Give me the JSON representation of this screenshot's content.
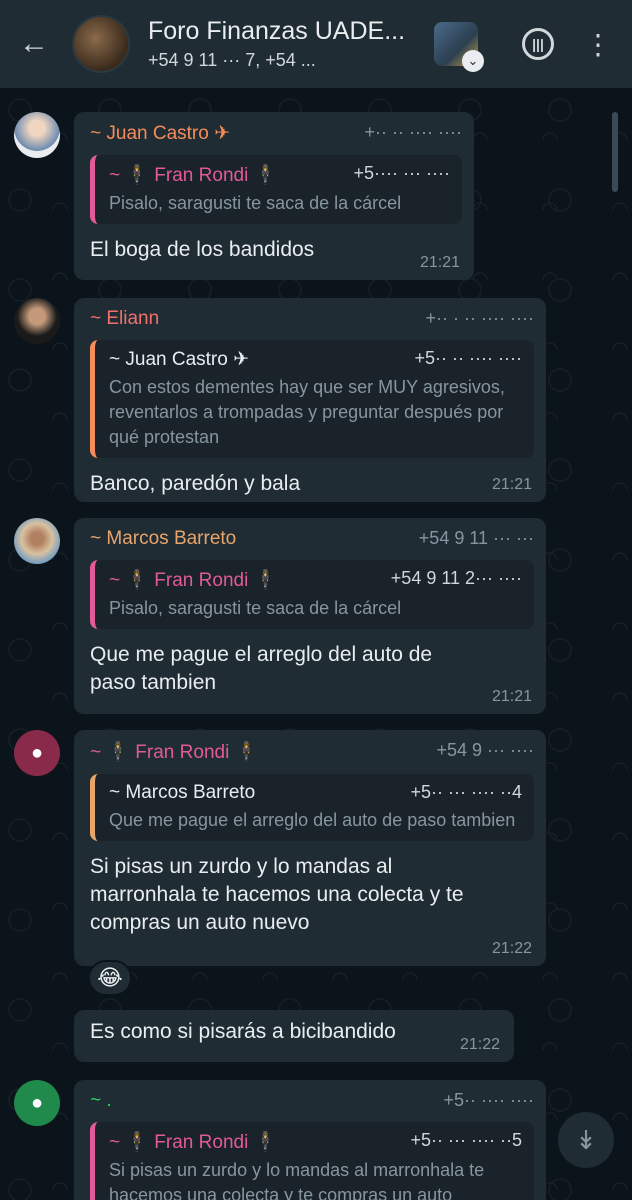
{
  "header": {
    "back_icon": "back-arrow-icon",
    "title": "Foro Finanzas UADE...",
    "subtitle": "+54 9 11 ··· 7, +54 ...",
    "call_icon": "voice-chat-icon",
    "menu_icon": "more-vertical-icon"
  },
  "messages": [
    {
      "sender": "~ Juan Castro ✈",
      "sender_color": "#f58c5a",
      "phone": "+·· ·· ···· ····",
      "quote": {
        "name": "~ 🕴 Fran Rondi 🕴",
        "name_color": "#e25a97",
        "phone": "+5···· ··· ····",
        "text": "Pisalo, saragusti te saca de la cárcel",
        "bar_color": "#e25a97"
      },
      "body": "El boga de los bandidos",
      "time": "21:21"
    },
    {
      "sender": "~ Eliann",
      "sender_color": "#f2706b",
      "phone": "+·· · ·· ···· ····",
      "quote": {
        "name": "~ Juan Castro ✈",
        "name_color": "#e9edef",
        "phone": "+5·· ·· ···· ····",
        "text": "Con estos dementes hay que ser MUY agresivos, reventarlos a trompadas y preguntar después por qué protestan",
        "bar_color": "#f58c5a"
      },
      "body": "Banco, paredón y bala",
      "time": "21:21"
    },
    {
      "sender": "~ Marcos Barreto",
      "sender_color": "#e8a56b",
      "phone": "+54 9 11 ··· ···",
      "quote": {
        "name": "~ 🕴 Fran Rondi 🕴",
        "name_color": "#e25a97",
        "phone": "+54 9 11 2··· ····",
        "text": "Pisalo, saragusti te saca de la cárcel",
        "bar_color": "#e25a97"
      },
      "body": "Que me pague el arreglo del auto de paso tambien",
      "time": "21:21"
    },
    {
      "sender": "~ 🕴 Fran Rondi 🕴",
      "sender_color": "#e25a97",
      "phone": "+54 9 ··· ····",
      "quote": {
        "name": "~ Marcos Barreto",
        "name_color": "#e9edef",
        "phone": "+5·· ··· ···· ··4",
        "text": "Que me pague el arreglo del auto de paso tambien",
        "bar_color": "#e8a56b"
      },
      "body": "Si pisas un zurdo y lo mandas al marronhala te hacemos una colecta y te compras un auto nuevo",
      "time": "21:22",
      "reaction": "😂"
    },
    {
      "body": "Es como si pisarás a bicibandido",
      "time": "21:22"
    },
    {
      "sender": "~ .",
      "sender_color": "#25d366",
      "phone": "+5·· ···· ····",
      "quote": {
        "name": "~ 🕴 Fran Rondi 🕴",
        "name_color": "#e25a97",
        "phone": "+5·· ··· ···· ··5",
        "text": "Si pisas un zurdo y lo mandas al marronhala te hacemos una colecta y te compras un auto",
        "bar_color": "#e25a97"
      }
    }
  ],
  "scroll_down_icon": "double-chevron-down-icon"
}
